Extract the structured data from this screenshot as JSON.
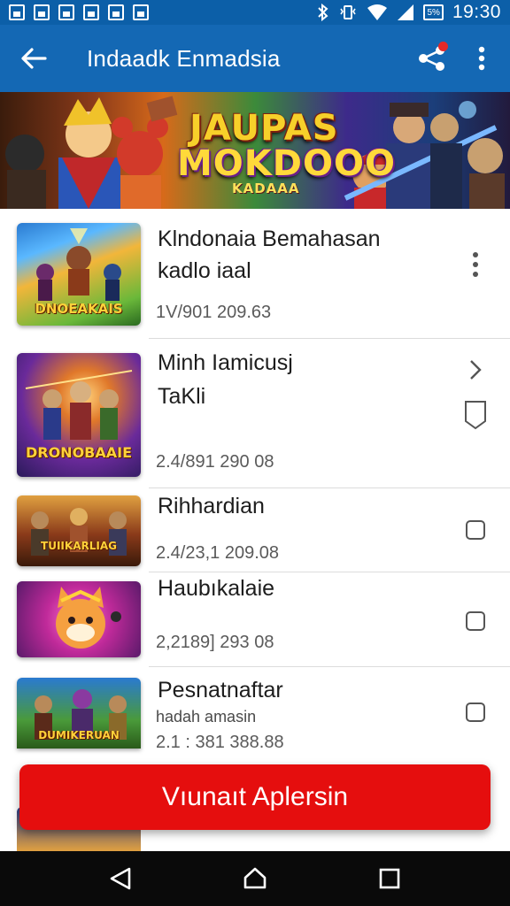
{
  "status_bar": {
    "time": "19:30",
    "battery": "5%"
  },
  "app_bar": {
    "title": "Indaadk Enmadsia"
  },
  "banner": {
    "line1": "JAUPAS",
    "line2": "MOKDOOO",
    "line3": "KADAAA"
  },
  "items": [
    {
      "name_line1": "Klndonaia Bemahasan",
      "name_line2": "kadlo iaal",
      "meta": "1V/901 209.63",
      "subtitle": "",
      "thumb_caption": "DNOEAKAIS",
      "action_icon": "more-vert-icon"
    },
    {
      "name_line1": "Minh Iamicusj",
      "name_line2": "TaKli",
      "meta": "2.4/891 290 08",
      "subtitle": "",
      "thumb_caption": "DRONOBAAIE",
      "action_icon": "chevron-right-icon"
    },
    {
      "name_line1": "Rihhardian",
      "name_line2": "",
      "meta": "2.4/23,1 209.08",
      "subtitle": "",
      "thumb_caption": "TUIIKARLIAG",
      "action_icon": "checkbox-icon"
    },
    {
      "name_line1": "Haubıkalaie",
      "name_line2": "",
      "meta": "2,2189] 293 08",
      "subtitle": "",
      "thumb_caption": "",
      "action_icon": "checkbox-icon"
    },
    {
      "name_line1": "Pesnatnaftar",
      "name_line2": "",
      "meta": "2.1 : 381 388.88",
      "subtitle": "hadah amasin",
      "thumb_caption": "DUMIKERUAN",
      "action_icon": "checkbox-icon"
    }
  ],
  "cta": {
    "label": "Vıunaıt Aplersin"
  },
  "colors": {
    "app_bar": "#1468b4",
    "status_bar": "#0c5fa8",
    "cta": "#e50e0e",
    "nav_bar": "#0a0a0a"
  }
}
